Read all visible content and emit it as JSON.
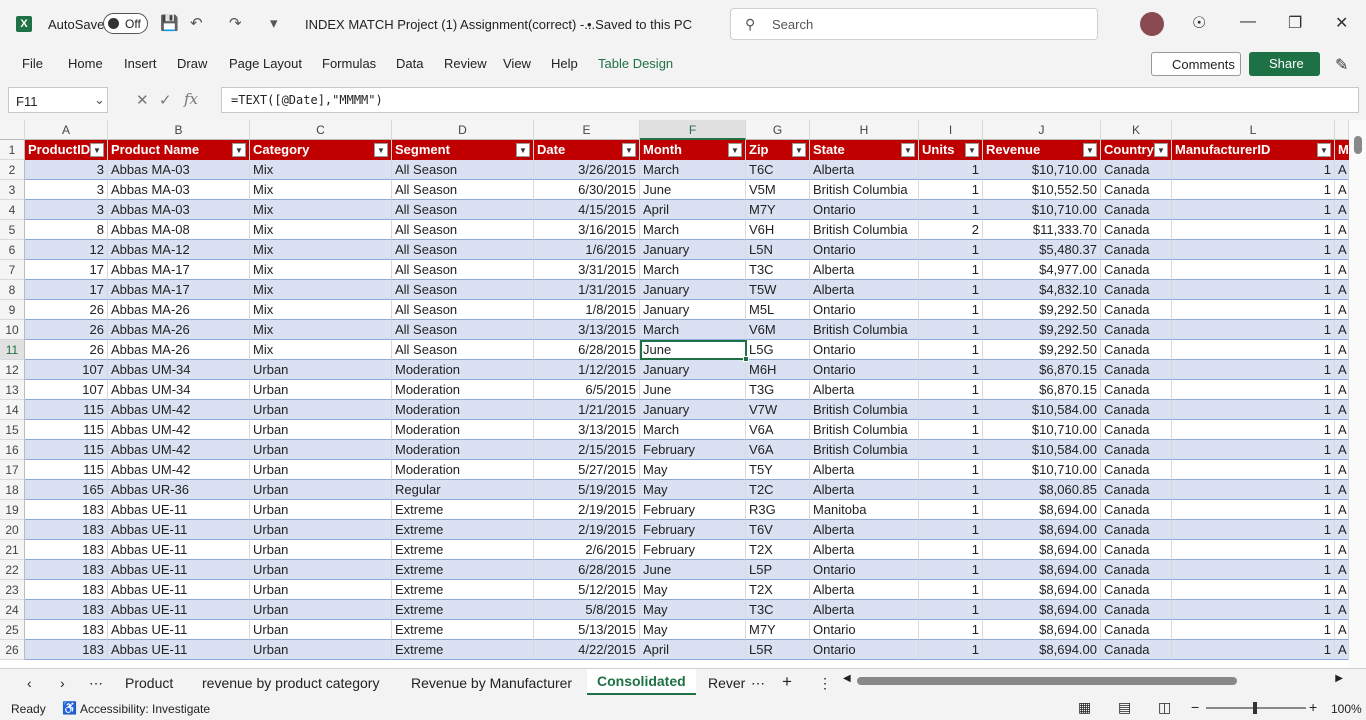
{
  "titlebar": {
    "autosave_label": "AutoSave",
    "autosave_state": "Off",
    "doc_title": "INDEX MATCH Project (1) Assignment(correct)  -...",
    "saved_status": "• Saved to this PC",
    "search_placeholder": "Search"
  },
  "ribbon": {
    "tabs": [
      "File",
      "Home",
      "Insert",
      "Draw",
      "Page Layout",
      "Formulas",
      "Data",
      "Review",
      "View",
      "Help",
      "Table Design"
    ],
    "comments_label": "Comments",
    "share_label": "Share"
  },
  "formula_bar": {
    "name_box": "F11",
    "formula": "=TEXT([@Date],\"MMMM\")"
  },
  "columns": [
    "A",
    "B",
    "C",
    "D",
    "E",
    "F",
    "G",
    "H",
    "I",
    "J",
    "K",
    "L"
  ],
  "header_row": [
    "ProductID",
    "Product Name",
    "Category",
    "Segment",
    "Date",
    "Month",
    "Zip",
    "State",
    "Units",
    "Revenue",
    "Country",
    "ManufacturerID",
    "M"
  ],
  "rows": [
    [
      "3",
      "Abbas MA-03",
      "Mix",
      "All Season",
      "3/26/2015",
      "March",
      "T6C",
      "Alberta",
      "1",
      "$10,710.00",
      "Canada",
      "1",
      "A"
    ],
    [
      "3",
      "Abbas MA-03",
      "Mix",
      "All Season",
      "6/30/2015",
      "June",
      "V5M",
      "British Columbia",
      "1",
      "$10,552.50",
      "Canada",
      "1",
      "A"
    ],
    [
      "3",
      "Abbas MA-03",
      "Mix",
      "All Season",
      "4/15/2015",
      "April",
      "M7Y",
      "Ontario",
      "1",
      "$10,710.00",
      "Canada",
      "1",
      "A"
    ],
    [
      "8",
      "Abbas MA-08",
      "Mix",
      "All Season",
      "3/16/2015",
      "March",
      "V6H",
      "British Columbia",
      "2",
      "$11,333.70",
      "Canada",
      "1",
      "A"
    ],
    [
      "12",
      "Abbas MA-12",
      "Mix",
      "All Season",
      "1/6/2015",
      "January",
      "L5N",
      "Ontario",
      "1",
      "$5,480.37",
      "Canada",
      "1",
      "A"
    ],
    [
      "17",
      "Abbas MA-17",
      "Mix",
      "All Season",
      "3/31/2015",
      "March",
      "T3C",
      "Alberta",
      "1",
      "$4,977.00",
      "Canada",
      "1",
      "A"
    ],
    [
      "17",
      "Abbas MA-17",
      "Mix",
      "All Season",
      "1/31/2015",
      "January",
      "T5W",
      "Alberta",
      "1",
      "$4,832.10",
      "Canada",
      "1",
      "A"
    ],
    [
      "26",
      "Abbas MA-26",
      "Mix",
      "All Season",
      "1/8/2015",
      "January",
      "M5L",
      "Ontario",
      "1",
      "$9,292.50",
      "Canada",
      "1",
      "A"
    ],
    [
      "26",
      "Abbas MA-26",
      "Mix",
      "All Season",
      "3/13/2015",
      "March",
      "V6M",
      "British Columbia",
      "1",
      "$9,292.50",
      "Canada",
      "1",
      "A"
    ],
    [
      "26",
      "Abbas MA-26",
      "Mix",
      "All Season",
      "6/28/2015",
      "June",
      "L5G",
      "Ontario",
      "1",
      "$9,292.50",
      "Canada",
      "1",
      "A"
    ],
    [
      "107",
      "Abbas UM-34",
      "Urban",
      "Moderation",
      "1/12/2015",
      "January",
      "M6H",
      "Ontario",
      "1",
      "$6,870.15",
      "Canada",
      "1",
      "A"
    ],
    [
      "107",
      "Abbas UM-34",
      "Urban",
      "Moderation",
      "6/5/2015",
      "June",
      "T3G",
      "Alberta",
      "1",
      "$6,870.15",
      "Canada",
      "1",
      "A"
    ],
    [
      "115",
      "Abbas UM-42",
      "Urban",
      "Moderation",
      "1/21/2015",
      "January",
      "V7W",
      "British Columbia",
      "1",
      "$10,584.00",
      "Canada",
      "1",
      "A"
    ],
    [
      "115",
      "Abbas UM-42",
      "Urban",
      "Moderation",
      "3/13/2015",
      "March",
      "V6A",
      "British Columbia",
      "1",
      "$10,710.00",
      "Canada",
      "1",
      "A"
    ],
    [
      "115",
      "Abbas UM-42",
      "Urban",
      "Moderation",
      "2/15/2015",
      "February",
      "V6A",
      "British Columbia",
      "1",
      "$10,584.00",
      "Canada",
      "1",
      "A"
    ],
    [
      "115",
      "Abbas UM-42",
      "Urban",
      "Moderation",
      "5/27/2015",
      "May",
      "T5Y",
      "Alberta",
      "1",
      "$10,710.00",
      "Canada",
      "1",
      "A"
    ],
    [
      "165",
      "Abbas UR-36",
      "Urban",
      "Regular",
      "5/19/2015",
      "May",
      "T2C",
      "Alberta",
      "1",
      "$8,060.85",
      "Canada",
      "1",
      "A"
    ],
    [
      "183",
      "Abbas UE-11",
      "Urban",
      "Extreme",
      "2/19/2015",
      "February",
      "R3G",
      "Manitoba",
      "1",
      "$8,694.00",
      "Canada",
      "1",
      "A"
    ],
    [
      "183",
      "Abbas UE-11",
      "Urban",
      "Extreme",
      "2/19/2015",
      "February",
      "T6V",
      "Alberta",
      "1",
      "$8,694.00",
      "Canada",
      "1",
      "A"
    ],
    [
      "183",
      "Abbas UE-11",
      "Urban",
      "Extreme",
      "2/6/2015",
      "February",
      "T2X",
      "Alberta",
      "1",
      "$8,694.00",
      "Canada",
      "1",
      "A"
    ],
    [
      "183",
      "Abbas UE-11",
      "Urban",
      "Extreme",
      "6/28/2015",
      "June",
      "L5P",
      "Ontario",
      "1",
      "$8,694.00",
      "Canada",
      "1",
      "A"
    ],
    [
      "183",
      "Abbas UE-11",
      "Urban",
      "Extreme",
      "5/12/2015",
      "May",
      "T2X",
      "Alberta",
      "1",
      "$8,694.00",
      "Canada",
      "1",
      "A"
    ],
    [
      "183",
      "Abbas UE-11",
      "Urban",
      "Extreme",
      "5/8/2015",
      "May",
      "T3C",
      "Alberta",
      "1",
      "$8,694.00",
      "Canada",
      "1",
      "A"
    ],
    [
      "183",
      "Abbas UE-11",
      "Urban",
      "Extreme",
      "5/13/2015",
      "May",
      "M7Y",
      "Ontario",
      "1",
      "$8,694.00",
      "Canada",
      "1",
      "A"
    ],
    [
      "183",
      "Abbas UE-11",
      "Urban",
      "Extreme",
      "4/22/2015",
      "April",
      "L5R",
      "Ontario",
      "1",
      "$8,694.00",
      "Canada",
      "1",
      "A"
    ]
  ],
  "sheet_tabs": [
    "Product",
    "revenue by product category",
    "Revenue by Manufacturer",
    "Consolidated",
    "Rever"
  ],
  "status": {
    "ready": "Ready",
    "accessibility": "Accessibility: Investigate",
    "zoom": "100%"
  },
  "colors": {
    "header_fill": "#c00000",
    "band_fill": "#d9e1f2",
    "accent": "#1e7145"
  }
}
